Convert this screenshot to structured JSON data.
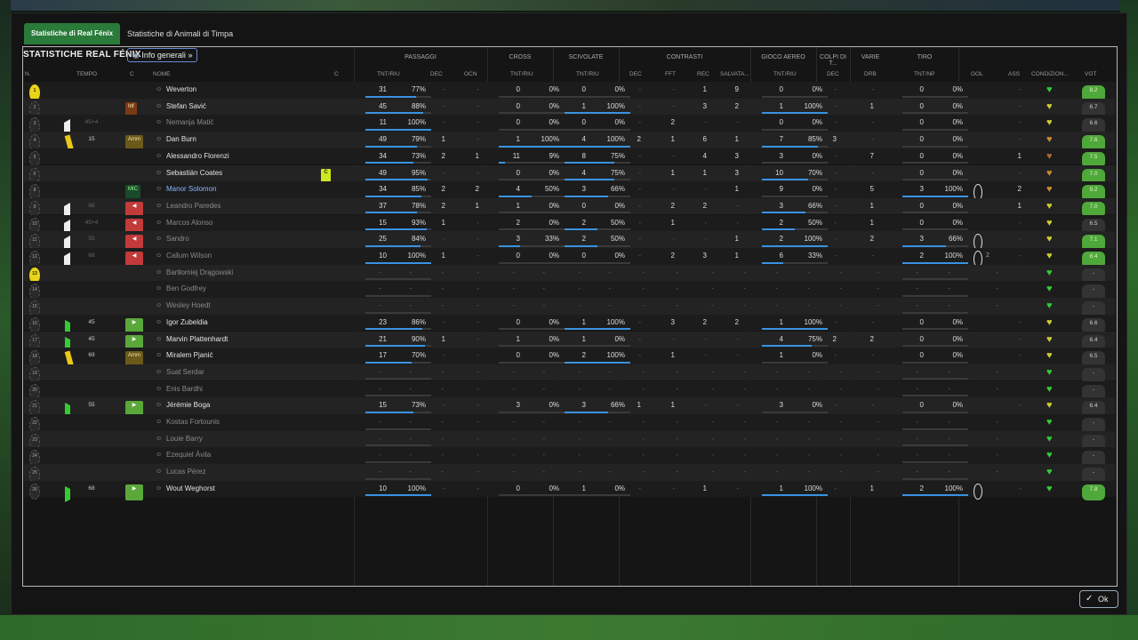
{
  "tabs": [
    "Statistiche di Real Fénix",
    "Statistiche di Animali di Timpa"
  ],
  "panel_title": "STATISTICHE REAL FÉNIX",
  "view_dropdown": "Info generali",
  "groups": [
    "PASSAGGI",
    "CROSS",
    "SCIVOLATE",
    "CONTRASTI",
    "GIOCO AEREO",
    "COLPI DI T...",
    "VARIE",
    "TIRO"
  ],
  "columns": {
    "n": "N.",
    "tempo": "TEMPO",
    "c1": "C",
    "nome": "NOME",
    "c2": "C",
    "pass_tnt": "TNT/RIU",
    "pass_dec": "DEC",
    "pass_ocn": "OCN",
    "cross_tnt": "TNT/RIU",
    "sciv_tnt": "TNT/RIU",
    "con_dec": "DEC",
    "con_fft": "FFT",
    "con_rec": "REC",
    "con_salv": "SALVATA...",
    "aereo_tnt": "TNT/RIU",
    "colpi_dec": "DEC",
    "varie_drb": "DRB",
    "tiro_tnt": "TNT/NP",
    "gol": "GOL",
    "ass": "ASS",
    "cond": "CONDIZION...",
    "vot": "VOT"
  },
  "players": [
    {
      "n": "1",
      "gk": true,
      "name": "Weverton",
      "style": "",
      "tempo": "",
      "card": "",
      "tag": "",
      "tagtype": "",
      "cap": false,
      "pass": [
        "31",
        "77%"
      ],
      "pbar": 0.77,
      "pdec": "-",
      "pocn": "-",
      "cross": [
        "0",
        "0%"
      ],
      "cbar": 0,
      "sciv": [
        "0",
        "0%"
      ],
      "sbar": 0,
      "cdec": "-",
      "fft": "-",
      "rec": "1",
      "salv": "9",
      "aereo": [
        "0",
        "0%"
      ],
      "abar": 0,
      "kdec": "-",
      "drb": "-",
      "tiro": [
        "0",
        "0%"
      ],
      "tbar": 0,
      "gol": "",
      "ass": "-",
      "cond": "#3c3",
      "vot": "8.2",
      "votc": "#4fa83a"
    },
    {
      "n": "2",
      "gk": false,
      "name": "Stefan Savić",
      "style": "",
      "tempo": "",
      "card": "",
      "tag": "Inf",
      "tagtype": "inf",
      "cap": false,
      "pass": [
        "45",
        "88%"
      ],
      "pbar": 0.88,
      "pdec": "-",
      "pocn": "-",
      "cross": [
        "0",
        "0%"
      ],
      "cbar": 0,
      "sciv": [
        "1",
        "100%"
      ],
      "sbar": 1,
      "cdec": "-",
      "fft": "-",
      "rec": "3",
      "salv": "2",
      "aereo": [
        "1",
        "100%"
      ],
      "abar": 1,
      "kdec": "-",
      "drb": "1",
      "tiro": [
        "0",
        "0%"
      ],
      "tbar": 0,
      "gol": "",
      "ass": "-",
      "cond": "#cc3",
      "vot": "6.7",
      "votc": "#333"
    },
    {
      "n": "3",
      "gk": false,
      "name": "Nemanja Matić",
      "style": "dim",
      "tempo": "45+4",
      "tri": "l",
      "card": "",
      "tag": "",
      "tagtype": "",
      "cap": false,
      "pass": [
        "11",
        "100%"
      ],
      "pbar": 1,
      "pdec": "-",
      "pocn": "-",
      "cross": [
        "0",
        "0%"
      ],
      "cbar": 0,
      "sciv": [
        "0",
        "0%"
      ],
      "sbar": 0,
      "cdec": "-",
      "fft": "2",
      "rec": "-",
      "salv": "-",
      "aereo": [
        "0",
        "0%"
      ],
      "abar": 0,
      "kdec": "-",
      "drb": "-",
      "tiro": [
        "0",
        "0%"
      ],
      "tbar": 0,
      "gol": "",
      "ass": "-",
      "cond": "#cc3",
      "vot": "6.6",
      "votc": "#333"
    },
    {
      "n": "4",
      "gk": false,
      "name": "Dan Burn",
      "style": "",
      "tempo": "15",
      "card": "y",
      "tag": "Amm",
      "tagtype": "amm",
      "cap": false,
      "pass": [
        "49",
        "79%"
      ],
      "pbar": 0.79,
      "pdec": "1",
      "pocn": "-",
      "cross": [
        "1",
        "100%"
      ],
      "cbar": 1,
      "sciv": [
        "4",
        "100%"
      ],
      "sbar": 1,
      "cdec": "2",
      "fft": "1",
      "rec": "6",
      "salv": "1",
      "aereo": [
        "7",
        "85%"
      ],
      "abar": 0.85,
      "kdec": "3",
      "drb": "-",
      "tiro": [
        "0",
        "0%"
      ],
      "tbar": 0,
      "gol": "",
      "ass": "-",
      "cond": "#c83",
      "vot": "7.6",
      "votc": "#4fa83a"
    },
    {
      "n": "5",
      "gk": false,
      "name": "Alessandro Florenzi",
      "style": "",
      "tempo": "",
      "card": "",
      "tag": "",
      "tagtype": "",
      "cap": false,
      "pass": [
        "34",
        "73%"
      ],
      "pbar": 0.73,
      "pdec": "2",
      "pocn": "1",
      "cross": [
        "11",
        "9%"
      ],
      "cbar": 0.09,
      "sciv": [
        "8",
        "75%"
      ],
      "sbar": 0.75,
      "cdec": "-",
      "fft": "-",
      "rec": "4",
      "salv": "3",
      "aereo": [
        "3",
        "0%"
      ],
      "abar": 0,
      "kdec": "-",
      "drb": "7",
      "tiro": [
        "0",
        "0%"
      ],
      "tbar": 0,
      "gol": "",
      "ass": "1",
      "cond": "#a63",
      "vot": "7.5",
      "votc": "#4fa83a"
    },
    {
      "n": "6",
      "gk": false,
      "name": "Sebastián Coates",
      "style": "",
      "tempo": "",
      "card": "",
      "tag": "",
      "tagtype": "",
      "cap": true,
      "pass": [
        "49",
        "95%"
      ],
      "pbar": 0.95,
      "pdec": "-",
      "pocn": "-",
      "cross": [
        "0",
        "0%"
      ],
      "cbar": 0,
      "sciv": [
        "4",
        "75%"
      ],
      "sbar": 0.75,
      "cdec": "-",
      "fft": "1",
      "rec": "1",
      "salv": "3",
      "aereo": [
        "10",
        "70%"
      ],
      "abar": 0.7,
      "kdec": "-",
      "drb": "-",
      "tiro": [
        "0",
        "0%"
      ],
      "tbar": 0,
      "gol": "",
      "ass": "-",
      "cond": "#c83",
      "vot": "7.0",
      "votc": "#4fa83a"
    },
    {
      "n": "8",
      "gk": false,
      "name": "Manor Solomon",
      "style": "blue",
      "tempo": "",
      "card": "",
      "tag": "MIC",
      "tagtype": "mic",
      "cap": false,
      "pass": [
        "34",
        "85%"
      ],
      "pbar": 0.85,
      "pdec": "2",
      "pocn": "2",
      "cross": [
        "4",
        "50%"
      ],
      "cbar": 0.5,
      "sciv": [
        "3",
        "66%"
      ],
      "sbar": 0.66,
      "cdec": "-",
      "fft": "-",
      "rec": "-",
      "salv": "1",
      "aereo": [
        "9",
        "0%"
      ],
      "abar": 0,
      "kdec": "-",
      "drb": "5",
      "tiro": [
        "3",
        "100%"
      ],
      "tbar": 1,
      "gol": "ball",
      "ass": "2",
      "cond": "#c83",
      "vot": "9.2",
      "votc": "#4fa83a"
    },
    {
      "n": "9",
      "gk": false,
      "name": "Leandro Paredes",
      "style": "dim",
      "tempo": "68",
      "tri": "l",
      "card": "",
      "tag": "◀",
      "tagtype": "out",
      "cap": false,
      "pass": [
        "37",
        "78%"
      ],
      "pbar": 0.78,
      "pdec": "2",
      "pocn": "1",
      "cross": [
        "1",
        "0%"
      ],
      "cbar": 0,
      "sciv": [
        "0",
        "0%"
      ],
      "sbar": 0,
      "cdec": "-",
      "fft": "2",
      "rec": "2",
      "salv": "-",
      "aereo": [
        "3",
        "66%"
      ],
      "abar": 0.66,
      "kdec": "-",
      "drb": "1",
      "tiro": [
        "0",
        "0%"
      ],
      "tbar": 0,
      "gol": "",
      "ass": "1",
      "cond": "#cc3",
      "vot": "7.0",
      "votc": "#4fa83a"
    },
    {
      "n": "10",
      "gk": false,
      "name": "Marcos Alonso",
      "style": "dim",
      "tempo": "45+4",
      "tri": "l",
      "card": "",
      "tag": "◀",
      "tagtype": "out",
      "cap": false,
      "pass": [
        "15",
        "93%"
      ],
      "pbar": 0.93,
      "pdec": "1",
      "pocn": "-",
      "cross": [
        "2",
        "0%"
      ],
      "cbar": 0,
      "sciv": [
        "2",
        "50%"
      ],
      "sbar": 0.5,
      "cdec": "-",
      "fft": "1",
      "rec": "-",
      "salv": "-",
      "aereo": [
        "2",
        "50%"
      ],
      "abar": 0.5,
      "kdec": "-",
      "drb": "1",
      "tiro": [
        "0",
        "0%"
      ],
      "tbar": 0,
      "gol": "",
      "ass": "-",
      "cond": "#cc3",
      "vot": "6.5",
      "votc": "#333"
    },
    {
      "n": "11",
      "gk": false,
      "name": "Sandro",
      "style": "dim",
      "tempo": "55",
      "tri": "l",
      "card": "",
      "tag": "◀",
      "tagtype": "out",
      "cap": false,
      "pass": [
        "25",
        "84%"
      ],
      "pbar": 0.84,
      "pdec": "-",
      "pocn": "-",
      "cross": [
        "3",
        "33%"
      ],
      "cbar": 0.33,
      "sciv": [
        "2",
        "50%"
      ],
      "sbar": 0.5,
      "cdec": "-",
      "fft": "-",
      "rec": "-",
      "salv": "1",
      "aereo": [
        "2",
        "100%"
      ],
      "abar": 1,
      "kdec": "-",
      "drb": "2",
      "tiro": [
        "3",
        "66%"
      ],
      "tbar": 0.66,
      "gol": "ball",
      "ass": "-",
      "cond": "#cc3",
      "vot": "7.1",
      "votc": "#4fa83a"
    },
    {
      "n": "12",
      "gk": false,
      "name": "Callum Wilson",
      "style": "dim",
      "tempo": "68",
      "tri": "l",
      "card": "",
      "tag": "◀",
      "tagtype": "out",
      "cap": false,
      "pass": [
        "10",
        "100%"
      ],
      "pbar": 1,
      "pdec": "1",
      "pocn": "-",
      "cross": [
        "0",
        "0%"
      ],
      "cbar": 0,
      "sciv": [
        "0",
        "0%"
      ],
      "sbar": 0,
      "cdec": "-",
      "fft": "2",
      "rec": "3",
      "salv": "1",
      "aereo": [
        "6",
        "33%"
      ],
      "abar": 0.33,
      "kdec": "-",
      "drb": "-",
      "tiro": [
        "2",
        "100%"
      ],
      "tbar": 1,
      "gol": "ball2",
      "ass": "-",
      "cond": "#cc3",
      "vot": "8.4",
      "votc": "#4fa83a"
    },
    {
      "n": "13",
      "gk": true,
      "name": "Bartłomiej Drągowski",
      "style": "dim",
      "tempo": "",
      "card": "",
      "tag": "",
      "tagtype": "",
      "cap": false,
      "empty": true,
      "cond": "#3c3",
      "vot": "-",
      "votc": "#333"
    },
    {
      "n": "14",
      "gk": false,
      "name": "Ben Godfrey",
      "style": "dim",
      "tempo": "",
      "card": "",
      "tag": "",
      "tagtype": "",
      "cap": false,
      "empty": true,
      "cond": "#3c3",
      "vot": "-",
      "votc": "#333"
    },
    {
      "n": "15",
      "gk": false,
      "name": "Wesley Hoedt",
      "style": "dim",
      "tempo": "",
      "card": "",
      "tag": "",
      "tagtype": "",
      "cap": false,
      "empty": true,
      "cond": "#3c3",
      "vot": "-",
      "votc": "#333"
    },
    {
      "n": "16",
      "gk": false,
      "name": "Igor Zubeldia",
      "style": "",
      "tempo": "45",
      "tri": "r",
      "card": "",
      "tag": "▶",
      "tagtype": "in",
      "cap": false,
      "pass": [
        "23",
        "86%"
      ],
      "pbar": 0.86,
      "pdec": "-",
      "pocn": "-",
      "cross": [
        "0",
        "0%"
      ],
      "cbar": 0,
      "sciv": [
        "1",
        "100%"
      ],
      "sbar": 1,
      "cdec": "-",
      "fft": "3",
      "rec": "2",
      "salv": "2",
      "aereo": [
        "1",
        "100%"
      ],
      "abar": 1,
      "kdec": "-",
      "drb": "-",
      "tiro": [
        "0",
        "0%"
      ],
      "tbar": 0,
      "gol": "",
      "ass": "-",
      "cond": "#cc3",
      "vot": "6.6",
      "votc": "#333"
    },
    {
      "n": "17",
      "gk": false,
      "name": "Marvin Plattenhardt",
      "style": "",
      "tempo": "45",
      "tri": "r",
      "card": "",
      "tag": "▶",
      "tagtype": "in",
      "cap": false,
      "pass": [
        "21",
        "90%"
      ],
      "pbar": 0.9,
      "pdec": "1",
      "pocn": "-",
      "cross": [
        "1",
        "0%"
      ],
      "cbar": 0,
      "sciv": [
        "1",
        "0%"
      ],
      "sbar": 0,
      "cdec": "-",
      "fft": "-",
      "rec": "-",
      "salv": "-",
      "aereo": [
        "4",
        "75%"
      ],
      "abar": 0.75,
      "kdec": "2",
      "drb": "2",
      "tiro": [
        "0",
        "0%"
      ],
      "tbar": 0,
      "gol": "",
      "ass": "-",
      "cond": "#cc3",
      "vot": "6.4",
      "votc": "#333"
    },
    {
      "n": "18",
      "gk": false,
      "name": "Miralem Pjanić",
      "style": "",
      "tempo": "69",
      "card": "y",
      "tag": "Amm",
      "tagtype": "amm",
      "cap": false,
      "pass": [
        "17",
        "70%"
      ],
      "pbar": 0.7,
      "pdec": "-",
      "pocn": "-",
      "cross": [
        "0",
        "0%"
      ],
      "cbar": 0,
      "sciv": [
        "2",
        "100%"
      ],
      "sbar": 1,
      "cdec": "-",
      "fft": "1",
      "rec": "-",
      "salv": "-",
      "aereo": [
        "1",
        "0%"
      ],
      "abar": 0,
      "kdec": "-",
      "drb": "-",
      "tiro": [
        "0",
        "0%"
      ],
      "tbar": 0,
      "gol": "",
      "ass": "-",
      "cond": "#cc3",
      "vot": "6.5",
      "votc": "#333"
    },
    {
      "n": "19",
      "gk": false,
      "name": "Suat Serdar",
      "style": "dim",
      "tempo": "",
      "card": "",
      "tag": "",
      "tagtype": "",
      "cap": false,
      "empty": true,
      "cond": "#3c3",
      "vot": "-",
      "votc": "#333"
    },
    {
      "n": "20",
      "gk": false,
      "name": "Enis Bardhi",
      "style": "dim",
      "tempo": "",
      "card": "",
      "tag": "",
      "tagtype": "",
      "cap": false,
      "empty": true,
      "cond": "#3c3",
      "vot": "-",
      "votc": "#333"
    },
    {
      "n": "21",
      "gk": false,
      "name": "Jérémie Boga",
      "style": "",
      "tempo": "55",
      "tri": "r",
      "card": "",
      "tag": "▶",
      "tagtype": "in",
      "cap": false,
      "pass": [
        "15",
        "73%"
      ],
      "pbar": 0.73,
      "pdec": "-",
      "pocn": "-",
      "cross": [
        "3",
        "0%"
      ],
      "cbar": 0,
      "sciv": [
        "3",
        "66%"
      ],
      "sbar": 0.66,
      "cdec": "1",
      "fft": "1",
      "rec": "-",
      "salv": "-",
      "aereo": [
        "3",
        "0%"
      ],
      "abar": 0,
      "kdec": "-",
      "drb": "-",
      "tiro": [
        "0",
        "0%"
      ],
      "tbar": 0,
      "gol": "",
      "ass": "-",
      "cond": "#cc3",
      "vot": "6.4",
      "votc": "#333"
    },
    {
      "n": "22",
      "gk": false,
      "name": "Kostas Fortounis",
      "style": "dim",
      "tempo": "",
      "card": "",
      "tag": "",
      "tagtype": "",
      "cap": false,
      "empty": true,
      "cond": "#3c3",
      "vot": "-",
      "votc": "#333"
    },
    {
      "n": "23",
      "gk": false,
      "name": "Louie Barry",
      "style": "dim",
      "tempo": "",
      "card": "",
      "tag": "",
      "tagtype": "",
      "cap": false,
      "empty": true,
      "cond": "#3c3",
      "vot": "-",
      "votc": "#333"
    },
    {
      "n": "24",
      "gk": false,
      "name": "Ezequiel Ávila",
      "style": "dim",
      "tempo": "",
      "card": "",
      "tag": "",
      "tagtype": "",
      "cap": false,
      "empty": true,
      "cond": "#3c3",
      "vot": "-",
      "votc": "#333"
    },
    {
      "n": "25",
      "gk": false,
      "name": "Lucas Pérez",
      "style": "dim",
      "tempo": "",
      "card": "",
      "tag": "",
      "tagtype": "",
      "cap": false,
      "empty": true,
      "cond": "#3c3",
      "vot": "-",
      "votc": "#333"
    },
    {
      "n": "26",
      "gk": false,
      "name": "Wout Weghorst",
      "style": "",
      "tempo": "68",
      "tri": "r",
      "card": "",
      "tag": "▶",
      "tagtype": "in",
      "cap": false,
      "pass": [
        "10",
        "100%"
      ],
      "pbar": 1,
      "pdec": "-",
      "pocn": "-",
      "cross": [
        "0",
        "0%"
      ],
      "cbar": 0,
      "sciv": [
        "1",
        "0%"
      ],
      "sbar": 0,
      "cdec": "-",
      "fft": "-",
      "rec": "1",
      "salv": "-",
      "aereo": [
        "1",
        "100%"
      ],
      "abar": 1,
      "kdec": "-",
      "drb": "1",
      "tiro": [
        "2",
        "100%"
      ],
      "tbar": 1,
      "gol": "ball",
      "ass": "-",
      "cond": "#3c3",
      "vot": "7.8",
      "votc": "#4fa83a"
    }
  ],
  "ok_label": "Ok",
  "colors": {
    "accent_green": "#2a7a3a",
    "bar_blue": "#3a92e0",
    "vote_green": "#4fa83a"
  }
}
